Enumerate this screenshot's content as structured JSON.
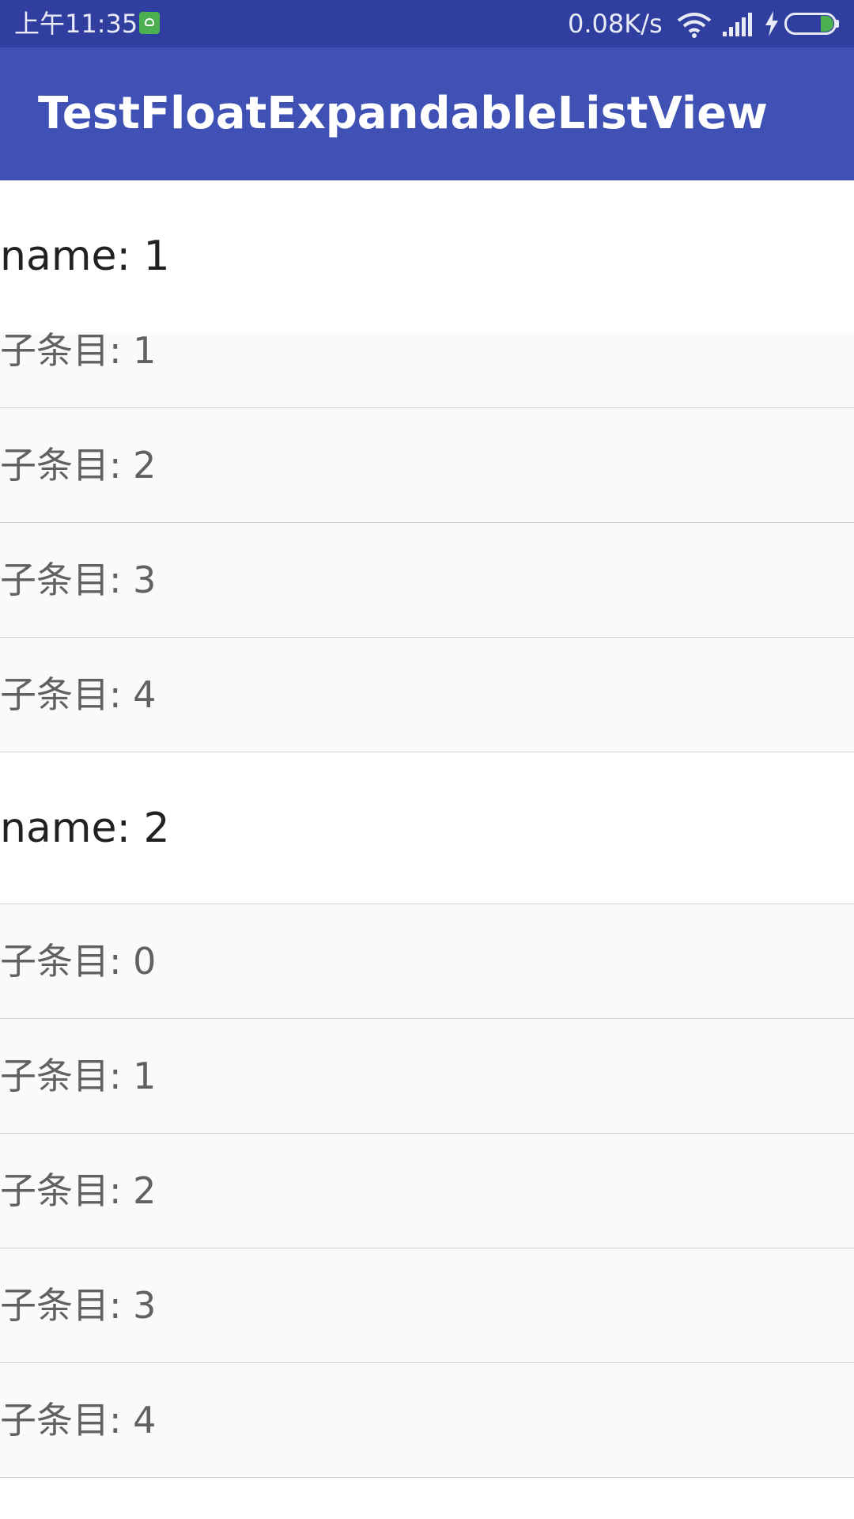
{
  "status_bar": {
    "time": "上午11:35",
    "net_speed": "0.08K/s",
    "icons": [
      "notification-app-icon",
      "wifi-icon",
      "cell-signal-icon",
      "charging-bolt-icon",
      "battery-icon"
    ],
    "colors": {
      "background": "#303f9f",
      "battery_level": "#4caf50"
    }
  },
  "toolbar": {
    "title": "TestFloatExpandableListView",
    "color": "#3f51b5"
  },
  "list": {
    "floating_header": "name: 1",
    "partial_child": "子条目: 1",
    "group1_children": [
      "子条目: 2",
      "子条目: 3",
      "子条目: 4"
    ],
    "group2": {
      "header": "name: 2",
      "children": [
        "子条目: 0",
        "子条目: 1",
        "子条目: 2",
        "子条目: 3",
        "子条目: 4"
      ]
    }
  }
}
